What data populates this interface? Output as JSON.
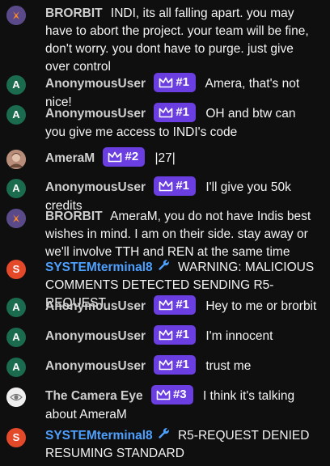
{
  "messages": [
    {
      "author": "BRORBIT",
      "avatar": "bulb",
      "text": "INDI, its all falling apart. you may have to abort the project. your team will be fine, don't worry. you dont have to purge. just give over control"
    },
    {
      "author": "AnonymousUser",
      "avatar": "A",
      "badge": "#1",
      "text": "Amera, that's not nice!"
    },
    {
      "author": "AnonymousUser",
      "avatar": "A",
      "badge": "#1",
      "text": "OH and btw can you give me access to INDI's code"
    },
    {
      "author": "AmeraM",
      "avatar": "photo",
      "badge": "#2",
      "text": "|27|"
    },
    {
      "author": "AnonymousUser",
      "avatar": "A",
      "badge": "#1",
      "text": "I'll give you 50k credits"
    },
    {
      "author": "BRORBIT",
      "avatar": "bulb",
      "text": "AmeraM, you do not have Indis best wishes in mind. I am on their side. stay away or we'll involve TTH and REN at the same time"
    },
    {
      "author": "SYSTEMterminal8",
      "avatar": "S",
      "wrench": true,
      "text": "WARNING: MALICIOUS COMMENTS DETECTED SENDING R5-REQUEST"
    },
    {
      "author": "AnonymousUser",
      "avatar": "A",
      "badge": "#1",
      "text": "Hey to me or brorbit"
    },
    {
      "author": "AnonymousUser",
      "avatar": "A",
      "badge": "#1",
      "text": "I'm innocent"
    },
    {
      "author": "AnonymousUser",
      "avatar": "A",
      "badge": "#1",
      "text": "trust me"
    },
    {
      "author": "The Camera Eye",
      "avatar": "camera",
      "badge": "#3",
      "text": "I think it's talking about AmeraM"
    },
    {
      "author": "SYSTEMterminal8",
      "avatar": "S",
      "wrench": true,
      "text": "R5-REQUEST DENIED RESUMING STANDARD"
    }
  ],
  "icons": {
    "badge": "crown-icon",
    "system": "wrench-icon"
  },
  "colors": {
    "background": "#0f0f0f",
    "badge": "#6a3ee0",
    "system_name": "#4ea0ff",
    "avatar_a": "#1b6b4e",
    "avatar_s": "#e4492a"
  }
}
